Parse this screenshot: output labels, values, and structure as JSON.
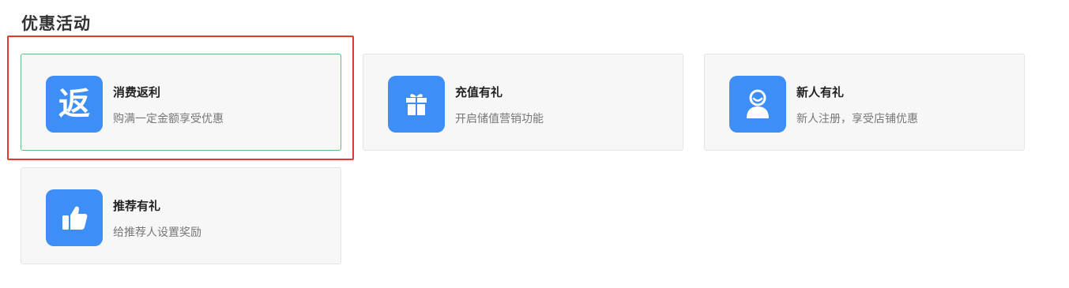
{
  "section": {
    "title": "优惠活动"
  },
  "cards": [
    {
      "title": "消费返利",
      "desc": "购满一定金额享受优惠",
      "icon": "rebate-icon",
      "icon_char": "返",
      "selected": true
    },
    {
      "title": "充值有礼",
      "desc": "开启储值营销功能",
      "icon": "gift-icon"
    },
    {
      "title": "新人有礼",
      "desc": "新人注册，享受店铺优惠",
      "icon": "user-icon"
    },
    {
      "title": "推荐有礼",
      "desc": "给推荐人设置奖励",
      "icon": "thumbs-up-icon"
    }
  ],
  "colors": {
    "icon_bg": "#3d8ef7",
    "selected_border": "#5fbf7f",
    "highlight_frame": "#e23b2e"
  }
}
